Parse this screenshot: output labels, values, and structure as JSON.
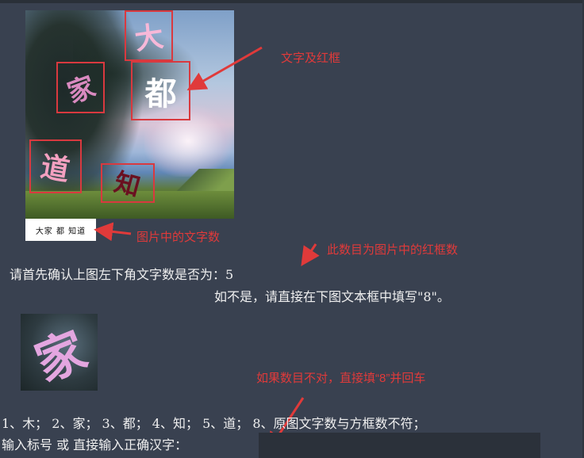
{
  "main_image": {
    "characters": [
      "大",
      "都",
      "家",
      "道",
      "知"
    ],
    "caption": "大家 都 知道"
  },
  "annotations": {
    "text_and_box": "文字及红框",
    "char_count": "图片中的文字数",
    "box_count": "此数目为图片中的红框数",
    "wrong_count": "如果数目不对，直接填“8”并回车"
  },
  "prompt": {
    "line1": "请首先确认上图左下角文字数是否为：5",
    "line2": "如不是，请直接在下图文本框中填写\"8\"。"
  },
  "thumbnail": {
    "character": "家"
  },
  "options": "1、木； 2、家； 3、都； 4、知； 5、道； 8、原图文字数与方框数不符；",
  "input": {
    "label": "输入标号 或 直接输入正确汉字：",
    "value": ""
  },
  "colors": {
    "background": "#394150",
    "annotation_red": "#e03a3a",
    "box_red": "#d9393f"
  },
  "icons": [
    "arrow-icon"
  ]
}
